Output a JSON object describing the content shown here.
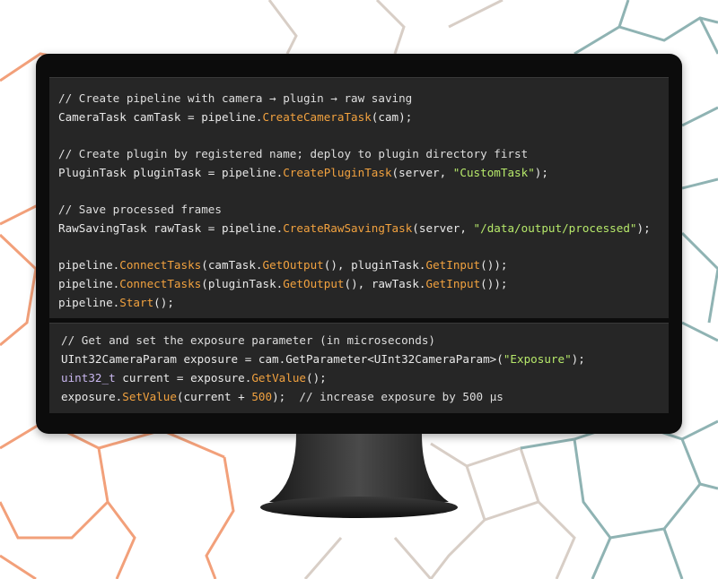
{
  "colors": {
    "hex_orange": "#f08a5d",
    "hex_teal": "#8ab0b0",
    "hex_grey": "#cfc8c2",
    "monitor_frame": "#0c0c0c",
    "code_background": "#262626",
    "method": "#f2a23f",
    "string": "#b6e86a",
    "type": "#c9b7ef"
  },
  "icons": [
    "monitor-stand-icon",
    "hexagon-background-icon"
  ],
  "code_block_1": {
    "comment_pipeline": "// Create pipeline with camera → plugin → raw saving",
    "line_camtask": {
      "pre": "CameraTask camTask = pipeline.",
      "method": "CreateCameraTask",
      "post": "(cam);"
    },
    "comment_plugin": "// Create plugin by registered name; deploy to plugin directory first",
    "line_plugintask": {
      "pre": "PluginTask pluginTask = pipeline.",
      "method": "CreatePluginTask",
      "mid": "(server, ",
      "string": "\"CustomTask\"",
      "post": ");"
    },
    "comment_save": "// Save processed frames",
    "line_rawtask": {
      "pre": "RawSavingTask rawTask = pipeline.",
      "method": "CreateRawSavingTask",
      "mid": "(server, ",
      "string": "\"/data/output/processed\"",
      "post": ");"
    },
    "line_connect_1": {
      "p1": "pipeline.",
      "m1": "ConnectTasks",
      "p2": "(camTask.",
      "m2": "GetOutput",
      "p3": "(), pluginTask.",
      "m3": "GetInput",
      "p4": "());"
    },
    "line_connect_2": {
      "p1": "pipeline.",
      "m1": "ConnectTasks",
      "p2": "(pluginTask.",
      "m2": "GetOutput",
      "p3": "(), rawTask.",
      "m3": "GetInput",
      "p4": "());"
    },
    "line_start": {
      "p1": "pipeline.",
      "m1": "Start",
      "p2": "();"
    }
  },
  "code_block_2": {
    "comment_exposure": "// Get and set the exposure parameter (in microseconds)",
    "line_param": {
      "pre": "UInt32CameraParam exposure = cam.GetParameter<UInt32CameraParam>(",
      "string": "\"Exposure\"",
      "post": ");"
    },
    "line_current": {
      "type": "uint32_t",
      "pre": " current = exposure.",
      "method": "GetValue",
      "post": "();"
    },
    "line_set": {
      "pre": "exposure.",
      "method": "SetValue",
      "mid": "(current + ",
      "number": "500",
      "post": ");  ",
      "comment": "// increase exposure by 500 µs"
    }
  }
}
